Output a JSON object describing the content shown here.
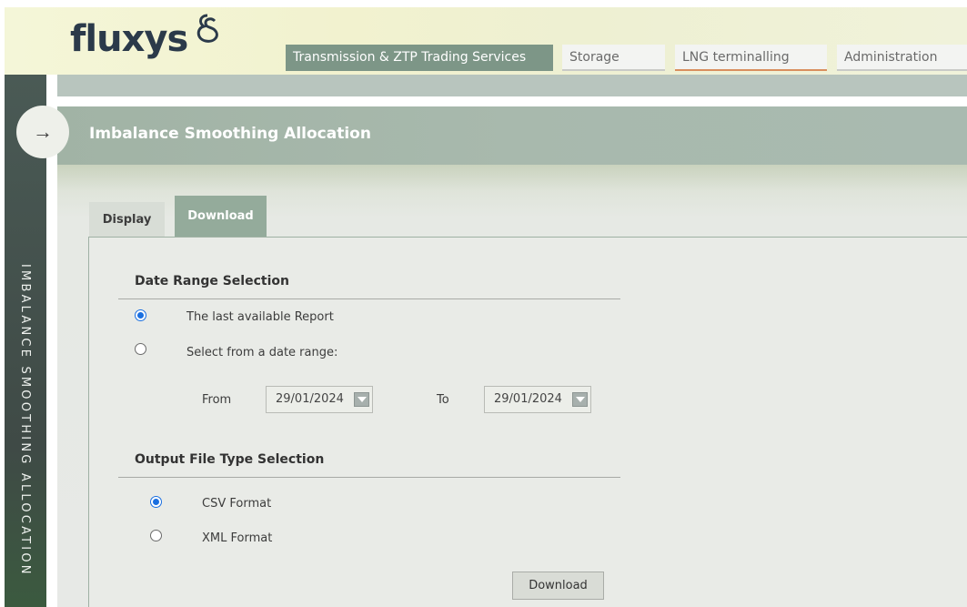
{
  "brand": {
    "logo_text": "fluxys"
  },
  "nav": {
    "tabs": [
      {
        "label": "Transmission & ZTP Trading Services",
        "active": true
      },
      {
        "label": "Storage",
        "active": false
      },
      {
        "label": "LNG terminalling",
        "active": false
      },
      {
        "label": "Administration",
        "active": false
      }
    ]
  },
  "sidebar": {
    "vertical_label": "IMBALANCE SMOOTHING ALLOCATION",
    "toggle_icon": "arrow-right-icon"
  },
  "page": {
    "title": "Imbalance Smoothing Allocation"
  },
  "content_tabs": [
    {
      "label": "Display",
      "active": false
    },
    {
      "label": "Download",
      "active": true
    }
  ],
  "date_range": {
    "title": "Date Range Selection",
    "options": [
      {
        "label": "The last available Report",
        "selected": true
      },
      {
        "label": "Select from a date range:",
        "selected": false
      }
    ],
    "from_label": "From",
    "from_value": "29/01/2024",
    "to_label": "To",
    "to_value": "29/01/2024"
  },
  "output_type": {
    "title": "Output File Type Selection",
    "options": [
      {
        "label": "CSV Format",
        "selected": true
      },
      {
        "label": "XML Format",
        "selected": false
      }
    ]
  },
  "actions": {
    "download_label": "Download"
  },
  "colors": {
    "accent": "#7d9687",
    "radio_selected": "#1a6fe0",
    "sidebar": "#444e4a"
  }
}
